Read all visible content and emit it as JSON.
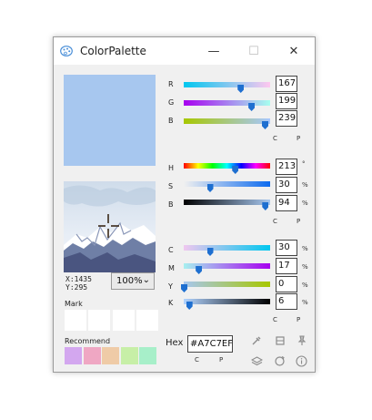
{
  "window": {
    "title": "ColorPalette",
    "minimize": "—",
    "maximize": "☐",
    "close": "✕"
  },
  "preview": {
    "color": "#A7C7EF"
  },
  "picker": {
    "x_label": "X:1435",
    "y_label": "Y:295",
    "zoom": "100%"
  },
  "mark": {
    "label": "Mark"
  },
  "recommend": {
    "label": "Recommend",
    "colors": [
      "#D3A7EF",
      "#EFA7C3",
      "#EFCBA7",
      "#C7EFA7",
      "#A7EFC9"
    ]
  },
  "rgb": {
    "r": {
      "label": "R",
      "value": "167",
      "fraction": 0.655
    },
    "g": {
      "label": "G",
      "value": "199",
      "fraction": 0.78
    },
    "b": {
      "label": "B",
      "value": "239",
      "fraction": 0.937
    },
    "copy": "C",
    "paste": "P"
  },
  "hsb": {
    "h": {
      "label": "H",
      "value": "213",
      "unit": "°",
      "fraction": 0.592
    },
    "s": {
      "label": "S",
      "value": "30",
      "unit": "%",
      "fraction": 0.3
    },
    "b": {
      "label": "B",
      "value": "94",
      "unit": "%",
      "fraction": 0.94
    },
    "copy": "C",
    "paste": "P"
  },
  "cmyk": {
    "c": {
      "label": "C",
      "value": "30",
      "unit": "%",
      "fraction": 0.3
    },
    "m": {
      "label": "M",
      "value": "17",
      "unit": "%",
      "fraction": 0.17
    },
    "y": {
      "label": "Y",
      "value": "0",
      "unit": "%",
      "fraction": 0.0
    },
    "k": {
      "label": "K",
      "value": "6",
      "unit": "%",
      "fraction": 0.06
    },
    "copy": "C",
    "paste": "P"
  },
  "hex": {
    "label": "Hex",
    "value": "#A7C7EF",
    "copy": "C",
    "paste": "P"
  }
}
